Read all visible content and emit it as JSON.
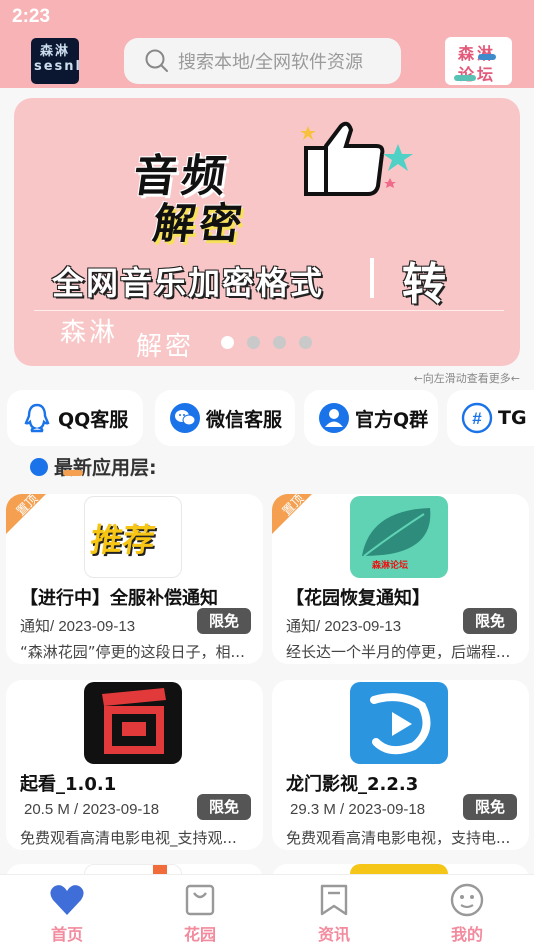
{
  "status_bar": {
    "time": "2:23"
  },
  "header": {
    "search_placeholder": "搜索本地/全网软件资源",
    "app_logo_text": "森淋 sesnlin",
    "forum_logo_line1": "森淋",
    "forum_logo_line2": "论坛"
  },
  "banner": {
    "title_line1": "音频",
    "title_line2": "解密",
    "subtitle": "全网音乐加密格式",
    "action": "转",
    "brand": "森淋",
    "brand_2": "解密",
    "slide_count": 4,
    "active_slide": 1
  },
  "hint": "←向左滑动查看更多←",
  "quick_links": [
    {
      "label": "QQ客服",
      "icon": "qq-icon"
    },
    {
      "label": "微信客服",
      "icon": "wechat-icon"
    },
    {
      "label": "官方Q群",
      "icon": "group-icon"
    },
    {
      "label": "TG",
      "icon": "hash-icon"
    }
  ],
  "section": {
    "title": "最新应用层:"
  },
  "cards": [
    {
      "title": "【进行中】全服补偿通知",
      "meta": "通知/ 2023-09-13",
      "badge": "限免",
      "desc": "“森淋花园”停更的这段日子，相...",
      "pinned": true,
      "pin_label": "置顶",
      "icon": "recommend-icon",
      "icon_text": "推荐"
    },
    {
      "title": "【花园恢复通知】",
      "meta": "通知/ 2023-09-13",
      "badge": "限免",
      "desc": "经长达一个半月的停更，后端程...",
      "pinned": true,
      "pin_label": "置顶",
      "icon": "leaf-icon",
      "icon_text": "森淋论坛"
    },
    {
      "title": "起看_1.0.1",
      "meta": "20.5 M / 2023-09-18",
      "badge": "限免",
      "desc": "免费观看高清电影电视_支持观...",
      "pinned": false,
      "icon": "qikan-icon"
    },
    {
      "title": "龙门影视_2.2.3",
      "meta": "29.3 M / 2023-09-18",
      "badge": "限免",
      "desc": "免费观看高清电影电视，支持电...",
      "pinned": false,
      "icon": "play-icon"
    }
  ],
  "tabs": [
    {
      "label": "首页",
      "icon": "heart-icon",
      "active": true
    },
    {
      "label": "花园",
      "icon": "bag-icon",
      "active": false
    },
    {
      "label": "资讯",
      "icon": "bookmark-icon",
      "active": false
    },
    {
      "label": "我的",
      "icon": "smile-icon",
      "active": false
    }
  ],
  "colors": {
    "topbar": "#f7b3b6",
    "accent": "#f28b9e",
    "banner": "#f8c6c7",
    "badge": "#555555",
    "pin": "#f4a050",
    "section_dot": "#1a73e8"
  }
}
